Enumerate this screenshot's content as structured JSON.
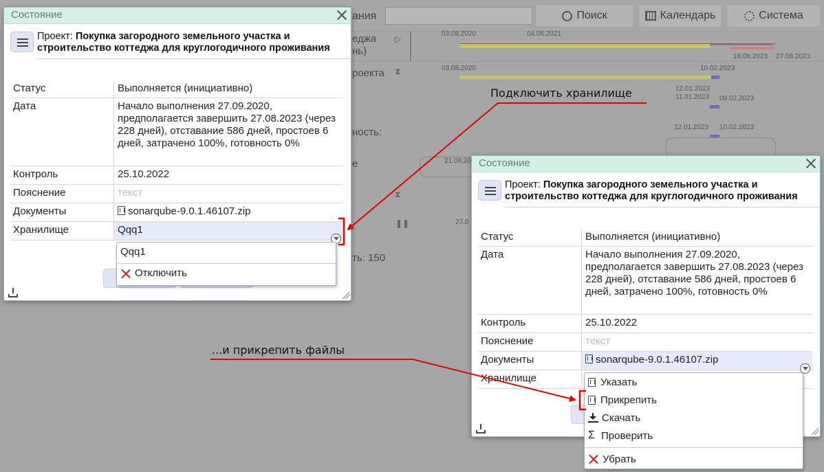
{
  "background": {
    "toolbar": {
      "tab_label_partial": "ания",
      "search_label": "Поиск",
      "calendar_label": "Календарь",
      "system_label": "Система"
    },
    "fragments": [
      "еджа",
      "нь)",
      "роекта",
      "ность:",
      "е",
      "ть: 150"
    ],
    "gantt_dates": [
      "03.08.2020",
      "04.06.2021",
      "18.08.2023",
      "27.08.2023",
      "03.08.2020",
      "10.02.2023",
      "12.01.2023",
      "11.01.2023",
      "09.02.2023",
      "12.01.2023",
      "10.02.2023",
      "21.08.20",
      "27.0"
    ]
  },
  "dialog1": {
    "title": "Состояние",
    "project_prefix": "Проект: ",
    "project_name": "Покупка загородного земельного участка и строительство коттеджа для круглогодичного проживания",
    "rows": [
      {
        "label": "Статус",
        "value": "Выполняется (инициативно)"
      },
      {
        "label": "Дата",
        "value": "Начало выполнения 27.09.2020, предполагается завершить 27.08.2023 (через 228 дней), отставание 586 дней, простоев 6 дней, затрачено 100%, готовность 0%"
      },
      {
        "label": "Контроль",
        "value": "25.10.2022"
      },
      {
        "label": "Пояснение",
        "value": "текст"
      },
      {
        "label": "Документы",
        "value": "sonarqube-9.0.1.46107.zip"
      },
      {
        "label": "Хранилище",
        "value": "Qqq1"
      }
    ],
    "popup": {
      "selected": "Qqq1",
      "items": [
        {
          "label": "Отключить",
          "icon": "x-red-icon"
        }
      ]
    }
  },
  "dialog2": {
    "title": "Состояние",
    "project_prefix": "Проект: ",
    "project_name": "Покупка загородного земельного участка и строительство коттеджа для круглогодичного проживания",
    "rows": [
      {
        "label": "Статус",
        "value": "Выполняется (инициативно)"
      },
      {
        "label": "Дата",
        "value": "Начало выполнения 27.09.2020, предполагается завершить 27.08.2023 (через 228 дней), отставание 586 дней, простоев 6 дней, затрачено 100%, готовность 0%"
      },
      {
        "label": "Контроль",
        "value": "25.10.2022"
      },
      {
        "label": "Пояснение",
        "value": "текст"
      },
      {
        "label": "Документы",
        "value": "sonarqube-9.0.1.46107.zip"
      },
      {
        "label": "Хранилище",
        "value": ""
      }
    ],
    "popup": {
      "items": [
        {
          "label": "Указать",
          "icon": "document-icon"
        },
        {
          "label": "Прикрепить",
          "icon": "document-icon"
        },
        {
          "label": "Скачать",
          "icon": "download-icon"
        },
        {
          "label": "Проверить",
          "icon": "sigma-icon"
        },
        {
          "label": "Убрать",
          "icon": "x-red-icon"
        }
      ]
    }
  },
  "annotations": {
    "connect_storage": "Подключить хранилище",
    "attach_files": "...и прикрепить файлы"
  },
  "colors": {
    "dialog_header": "#d4f1e6",
    "selection": "#e4e9fb",
    "annotation_arrow": "#e00000"
  }
}
